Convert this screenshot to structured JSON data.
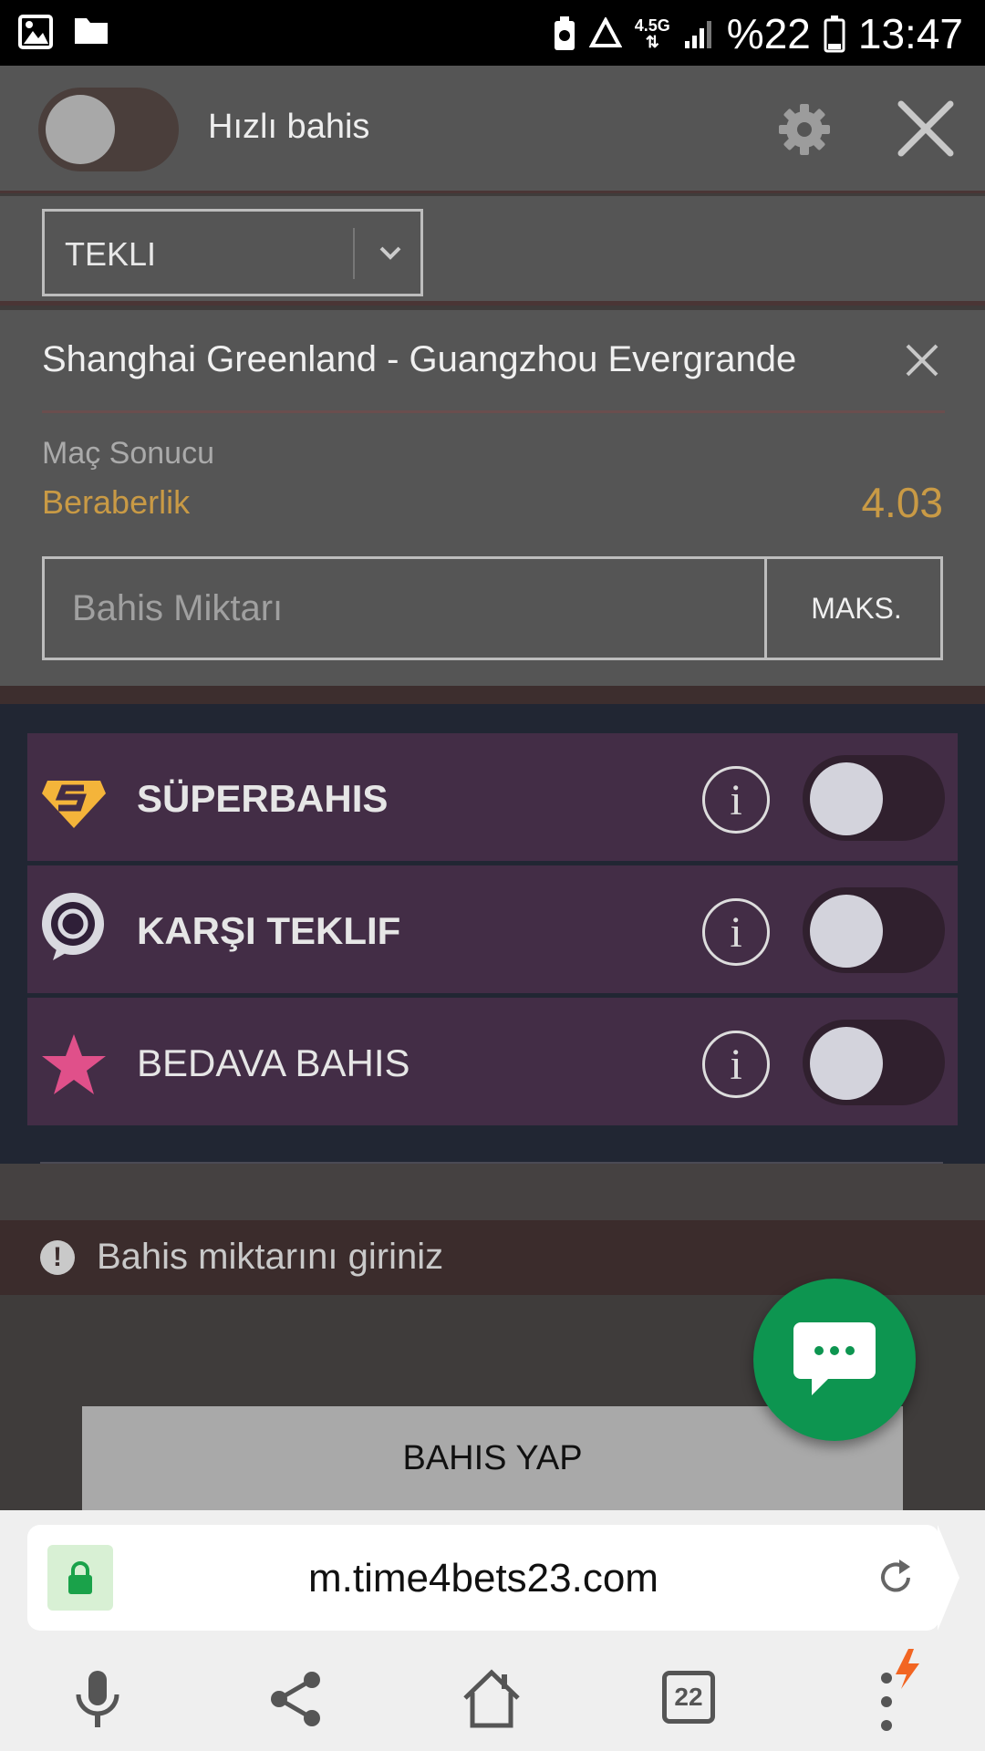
{
  "status_bar": {
    "network": "4.5G",
    "battery": "%22",
    "time": "13:47"
  },
  "header": {
    "quick_bet_label": "Hızlı bahis"
  },
  "bet_type": {
    "selected": "TEKLI"
  },
  "event": {
    "match": "Shanghai Greenland - Guangzhou Evergrande",
    "market": "Maç Sonucu",
    "selection": "Beraberlik",
    "odds": "4.03"
  },
  "stake": {
    "placeholder": "Bahis Miktarı",
    "value": "",
    "max_label": "MAKS."
  },
  "promotions": [
    {
      "label": "SÜPERBAHIS",
      "icon": "superbahis-icon",
      "enabled": false
    },
    {
      "label": "KARŞI TEKLIF",
      "icon": "counter-offer-icon",
      "enabled": false
    },
    {
      "label": "BEDAVA BAHIS",
      "icon": "star-icon",
      "enabled": false
    }
  ],
  "warning": {
    "text": "Bahis miktarını giriniz"
  },
  "place_bet": {
    "label": "BAHIS YAP"
  },
  "browser": {
    "url": "m.time4bets23.com",
    "tab_count": "22"
  },
  "colors": {
    "accent_gold": "#c99a45",
    "promo_row": "#432d46",
    "chat_green": "#0d9550"
  }
}
